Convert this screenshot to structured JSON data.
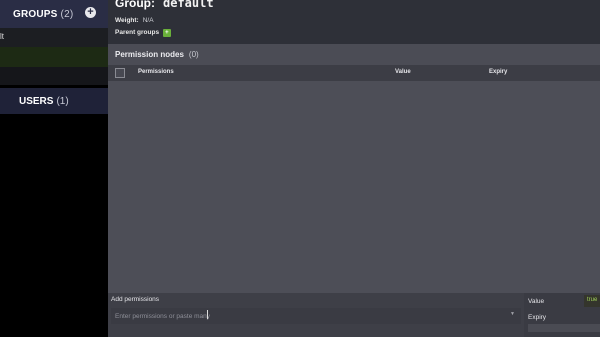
{
  "sidebar": {
    "groups_title": "GROUPS",
    "groups_count": "(2)",
    "add_icon": "+",
    "groups": [
      {
        "label": "lt"
      }
    ],
    "users_title": "USERS",
    "users_count": "(1)"
  },
  "group": {
    "title": "Group:",
    "name": "default",
    "weight_label": "Weight:",
    "weight_value": "N/A",
    "parents_label": "Parent groups",
    "parents_badge": "+"
  },
  "permissions": {
    "title": "Permission nodes",
    "count": "(0)",
    "columns": {
      "permissions": "Permissions",
      "value": "Value",
      "expiry": "Expiry"
    }
  },
  "add": {
    "label": "Add permissions",
    "placeholder": "Enter permissions or paste many",
    "dropdown_icon": "▼",
    "value_label": "Value",
    "value_current": "true",
    "expiry_label": "Expiry"
  },
  "colors": {
    "sidebar_header": "#2a2d45",
    "accent_green": "#6ab03a",
    "panel": "#4b4c55"
  }
}
